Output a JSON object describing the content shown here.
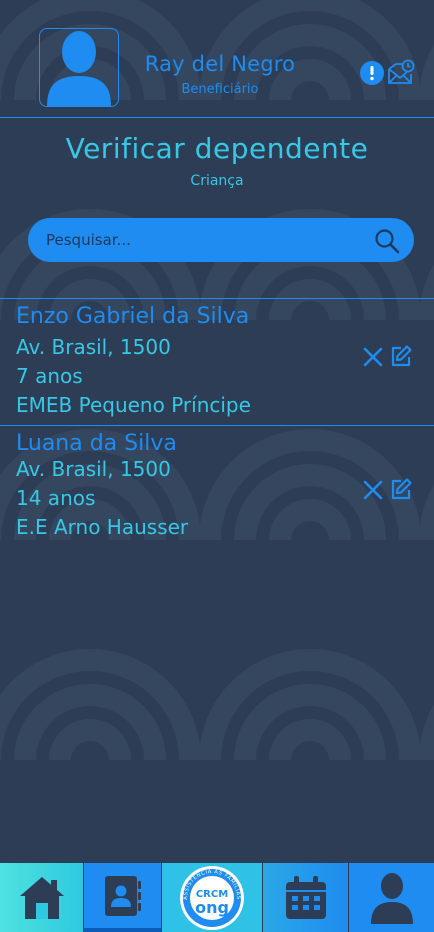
{
  "header": {
    "user_name": "Ray del Negro",
    "user_role": "Beneficiário"
  },
  "page": {
    "title": "Verificar dependente",
    "subtitle": "Criança"
  },
  "search": {
    "placeholder": "Pesquisar..."
  },
  "dependents": [
    {
      "name": "Enzo Gabriel da Silva",
      "address": "Av. Brasil, 1500",
      "age": "7 anos",
      "school": "EMEB Pequeno Príncipe"
    },
    {
      "name": "Luana da Silva",
      "address": "Av. Brasil, 1500",
      "age": "14 anos",
      "school": "E.E Arno Hausser"
    }
  ],
  "nav": {
    "logo_text": "CRCM",
    "logo_sub": "ong",
    "logo_ring": "ASSISTÊNCIA ÀS FAMÍLIAS",
    "items": [
      "home-icon",
      "contacts-icon",
      "crcm-ong-logo",
      "calendar-icon",
      "profile-icon"
    ]
  },
  "colors": {
    "background": "#2c3d55",
    "primary_blue": "#1e8cf0",
    "cyan_text": "#37c8e6",
    "nav_teal": "#4ee2df"
  }
}
